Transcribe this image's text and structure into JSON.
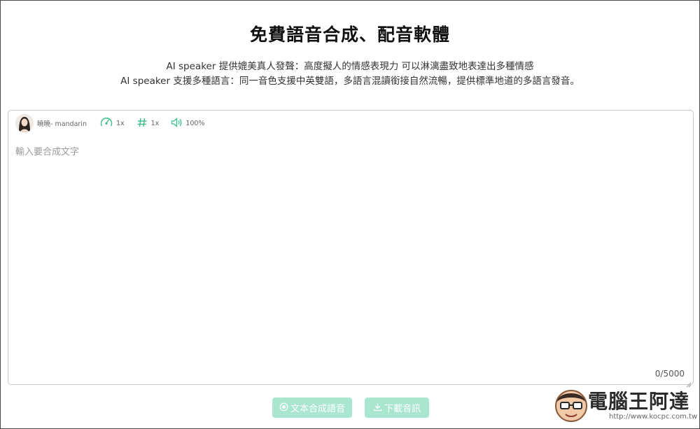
{
  "header": {
    "title": "免費語音合成、配音軟體",
    "line1": "AI speaker 提供媲美真人發聲：高度擬人的情感表現力 可以淋漓盡致地表達出多種情感",
    "line2": "AI speaker 支援多種語言：同一音色支援中英雙語，多語言混讀銜接自然流暢，提供標準地道的多語言發音。"
  },
  "toolbar": {
    "voice_name": "曉曉- mandarin",
    "speed": "1x",
    "pitch": "1x",
    "volume": "100%",
    "icons": {
      "speed": "speedometer-icon",
      "pitch": "hash-icon",
      "volume": "speaker-icon"
    },
    "accent_color": "#3cbf8a"
  },
  "editor": {
    "placeholder": "輸入要合成文字",
    "counter": "0/5000"
  },
  "actions": {
    "synthesize_label": "文本合成語音",
    "download_label": "下載音訊",
    "button_color": "#a8e6cf"
  },
  "watermark": {
    "text": "電腦王阿達",
    "url": "http://www.kocpc.com.tw"
  }
}
